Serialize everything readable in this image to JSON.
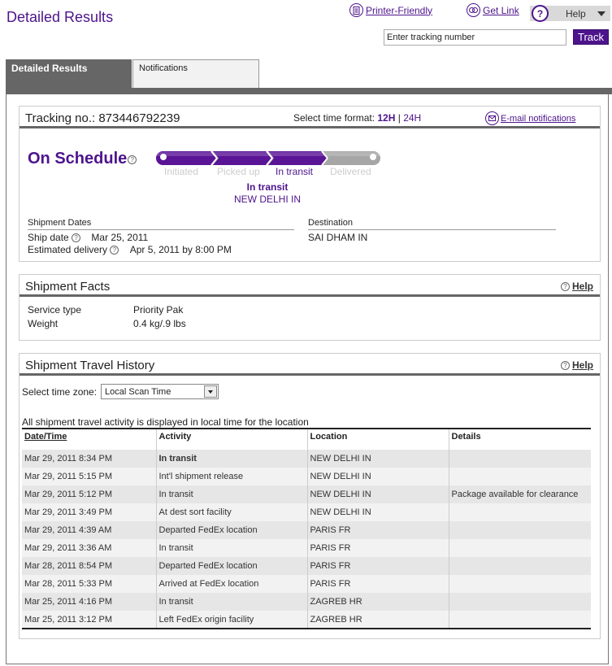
{
  "header": {
    "title": "Detailed Results",
    "printer_friendly": "Printer-Friendly",
    "get_link": "Get Link",
    "help_label": "Help",
    "tracking_input_placeholder": "Enter tracking number",
    "track_button": "Track"
  },
  "tabs": [
    {
      "label": "Detailed Results",
      "active": true
    },
    {
      "label": "Notifications",
      "active": false
    }
  ],
  "summary": {
    "tracking_label": "Tracking no.: 873446792239",
    "time_format_label": "Select time format:",
    "time_format_12h": "12H",
    "time_format_sep": "|",
    "time_format_24h": "24H",
    "email_notifications": "E-mail notifications",
    "status": "On Schedule",
    "progress_steps": [
      "Initiated",
      "Picked up",
      "In transit",
      "Delivered"
    ],
    "progress_current_step": 3,
    "current_status": "In transit",
    "current_location": "NEW DELHI IN",
    "shipment_dates_label": "Shipment Dates",
    "ship_date_label": "Ship date",
    "ship_date": "Mar 25, 2011",
    "est_delivery_label": "Estimated delivery",
    "est_delivery": "Apr 5, 2011 by 8:00 PM",
    "destination_label": "Destination",
    "destination": "SAI DHAM IN"
  },
  "facts": {
    "title": "Shipment Facts",
    "help": "Help",
    "rows": [
      {
        "label": "Service type",
        "value": "Priority Pak"
      },
      {
        "label": "Weight",
        "value": "0.4 kg/.9 lbs"
      }
    ]
  },
  "history": {
    "title": "Shipment Travel History",
    "help": "Help",
    "timezone_label": "Select time zone:",
    "timezone_value": "Local Scan Time",
    "note": "All shipment travel activity is displayed in local time for the location",
    "columns": [
      "Date/Time",
      "Activity",
      "Location",
      "Details"
    ],
    "rows": [
      {
        "datetime": "Mar 29, 2011 8:34 PM",
        "activity": "In transit",
        "location": "NEW DELHI IN",
        "details": "",
        "bold": true
      },
      {
        "datetime": "Mar 29, 2011 5:15 PM",
        "activity": "Int'l shipment release",
        "location": "NEW DELHI IN",
        "details": ""
      },
      {
        "datetime": "Mar 29, 2011 5:12 PM",
        "activity": "In transit",
        "location": "NEW DELHI IN",
        "details": "Package available for clearance"
      },
      {
        "datetime": "Mar 29, 2011 3:49 PM",
        "activity": "At dest sort facility",
        "location": "NEW DELHI IN",
        "details": ""
      },
      {
        "datetime": "Mar 29, 2011 4:39 AM",
        "activity": "Departed FedEx location",
        "location": "PARIS FR",
        "details": ""
      },
      {
        "datetime": "Mar 29, 2011 3:36 AM",
        "activity": "In transit",
        "location": "PARIS FR",
        "details": ""
      },
      {
        "datetime": "Mar 28, 2011 8:54 PM",
        "activity": "Departed FedEx location",
        "location": "PARIS FR",
        "details": ""
      },
      {
        "datetime": "Mar 28, 2011 5:33 PM",
        "activity": "Arrived at FedEx location",
        "location": "PARIS FR",
        "details": ""
      },
      {
        "datetime": "Mar 25, 2011 4:16 PM",
        "activity": "In transit",
        "location": "ZAGREB HR",
        "details": ""
      },
      {
        "datetime": "Mar 25, 2011 3:12 PM",
        "activity": "Left FedEx origin facility",
        "location": "ZAGREB HR",
        "details": ""
      }
    ]
  },
  "colors": {
    "brand_purple": "#4d148c",
    "tab_gray": "#666666",
    "progress_inactive": "#a6a6a6"
  }
}
